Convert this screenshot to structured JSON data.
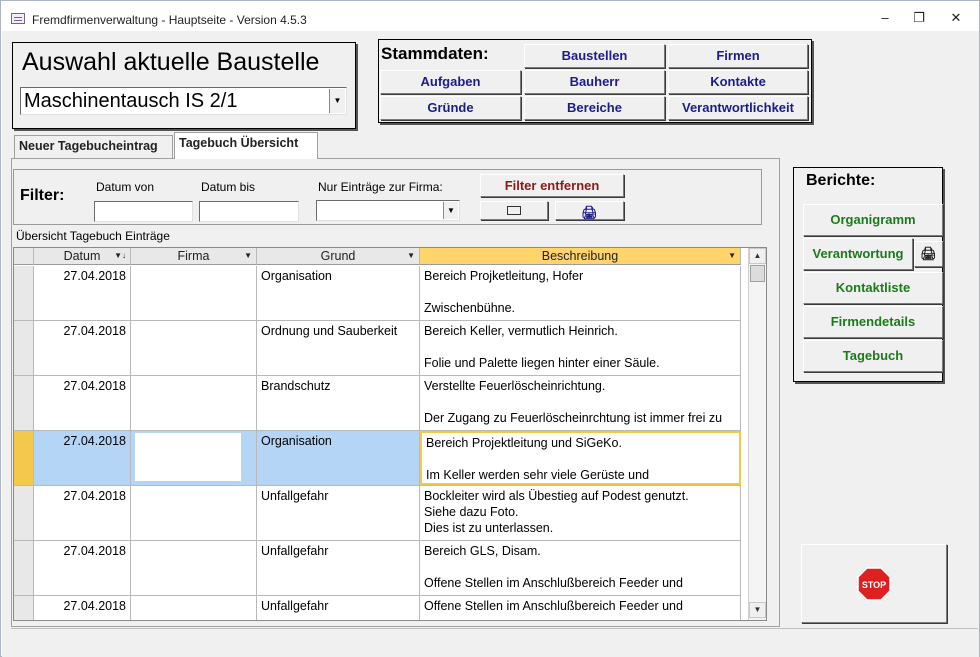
{
  "window": {
    "title": "Fremdfirmenverwaltung - Hauptseite - Version 4.5.3"
  },
  "baustelle": {
    "heading": "Auswahl aktuelle Baustelle",
    "selected": "Maschinentausch IS 2/1"
  },
  "stammdaten": {
    "heading": "Stammdaten:",
    "buttons": [
      "Baustellen",
      "Firmen",
      "Aufgaben",
      "Bauherr",
      "Kontakte",
      "Gründe",
      "Bereiche",
      "Verantwortlichkeit"
    ]
  },
  "tabs": {
    "neuer_eintrag": "Neuer Tagebucheintrag",
    "uebersicht": "Tagebuch Übersicht"
  },
  "filter": {
    "label": "Filter:",
    "datum_von": "Datum von",
    "datum_bis": "Datum bis",
    "firma": "Nur Einträge zur Firma:",
    "remove": "Filter entfernen"
  },
  "grid": {
    "caption": "Übersicht Tagebuch Einträge",
    "columns": [
      "Datum",
      "Firma",
      "Grund",
      "Beschreibung"
    ],
    "rows": [
      {
        "datum": "27.04.2018",
        "firma": "",
        "grund": "Organisation",
        "beschreibung": "Bereich Projketleitung, Hofer\n\nZwischenbühne."
      },
      {
        "datum": "27.04.2018",
        "firma": "",
        "grund": "Ordnung und Sauberkeit",
        "beschreibung": "Bereich Keller, vermutlich Heinrich.\n\nFolie und Palette liegen hinter einer Säule."
      },
      {
        "datum": "27.04.2018",
        "firma": "",
        "grund": "Brandschutz",
        "beschreibung": "Verstellte Feuerlöscheinrichtung.\n\nDer Zugang zu Feuerlöscheinrchtung ist immer frei zu"
      },
      {
        "datum": "27.04.2018",
        "firma": "",
        "grund": "Organisation",
        "beschreibung": "Bereich Projektleitung und SiGeKo.\n\nIm Keller werden sehr viele Gerüste und"
      },
      {
        "datum": "27.04.2018",
        "firma": "",
        "grund": "Unfallgefahr",
        "beschreibung": "Bockleiter wird als Übestieg auf Podest genutzt.\nSiehe dazu Foto.\nDies ist zu unterlassen."
      },
      {
        "datum": "27.04.2018",
        "firma": "",
        "grund": "Unfallgefahr",
        "beschreibung": "Bereich GLS, Disam.\n\nOffene Stellen im Anschlußbereich Feeder und"
      },
      {
        "datum": "27.04.2018",
        "firma": "",
        "grund": "Unfallgefahr",
        "beschreibung": "Offene Stellen im Anschlußbereich Feeder und"
      }
    ]
  },
  "berichte": {
    "heading": "Berichte:",
    "buttons": [
      "Organigramm",
      "Verantwortung",
      "Kontaktliste",
      "Firmendetails",
      "Tagebuch"
    ]
  },
  "stop": {
    "label": "STOP"
  },
  "colors": {
    "link_blue": "#1c1c8c",
    "report_green": "#1b7a1b",
    "filter_red": "#8b1a1a",
    "selection": "#b4d5f6",
    "highlight_header": "#ffd56b",
    "stop_red": "#e02020"
  }
}
